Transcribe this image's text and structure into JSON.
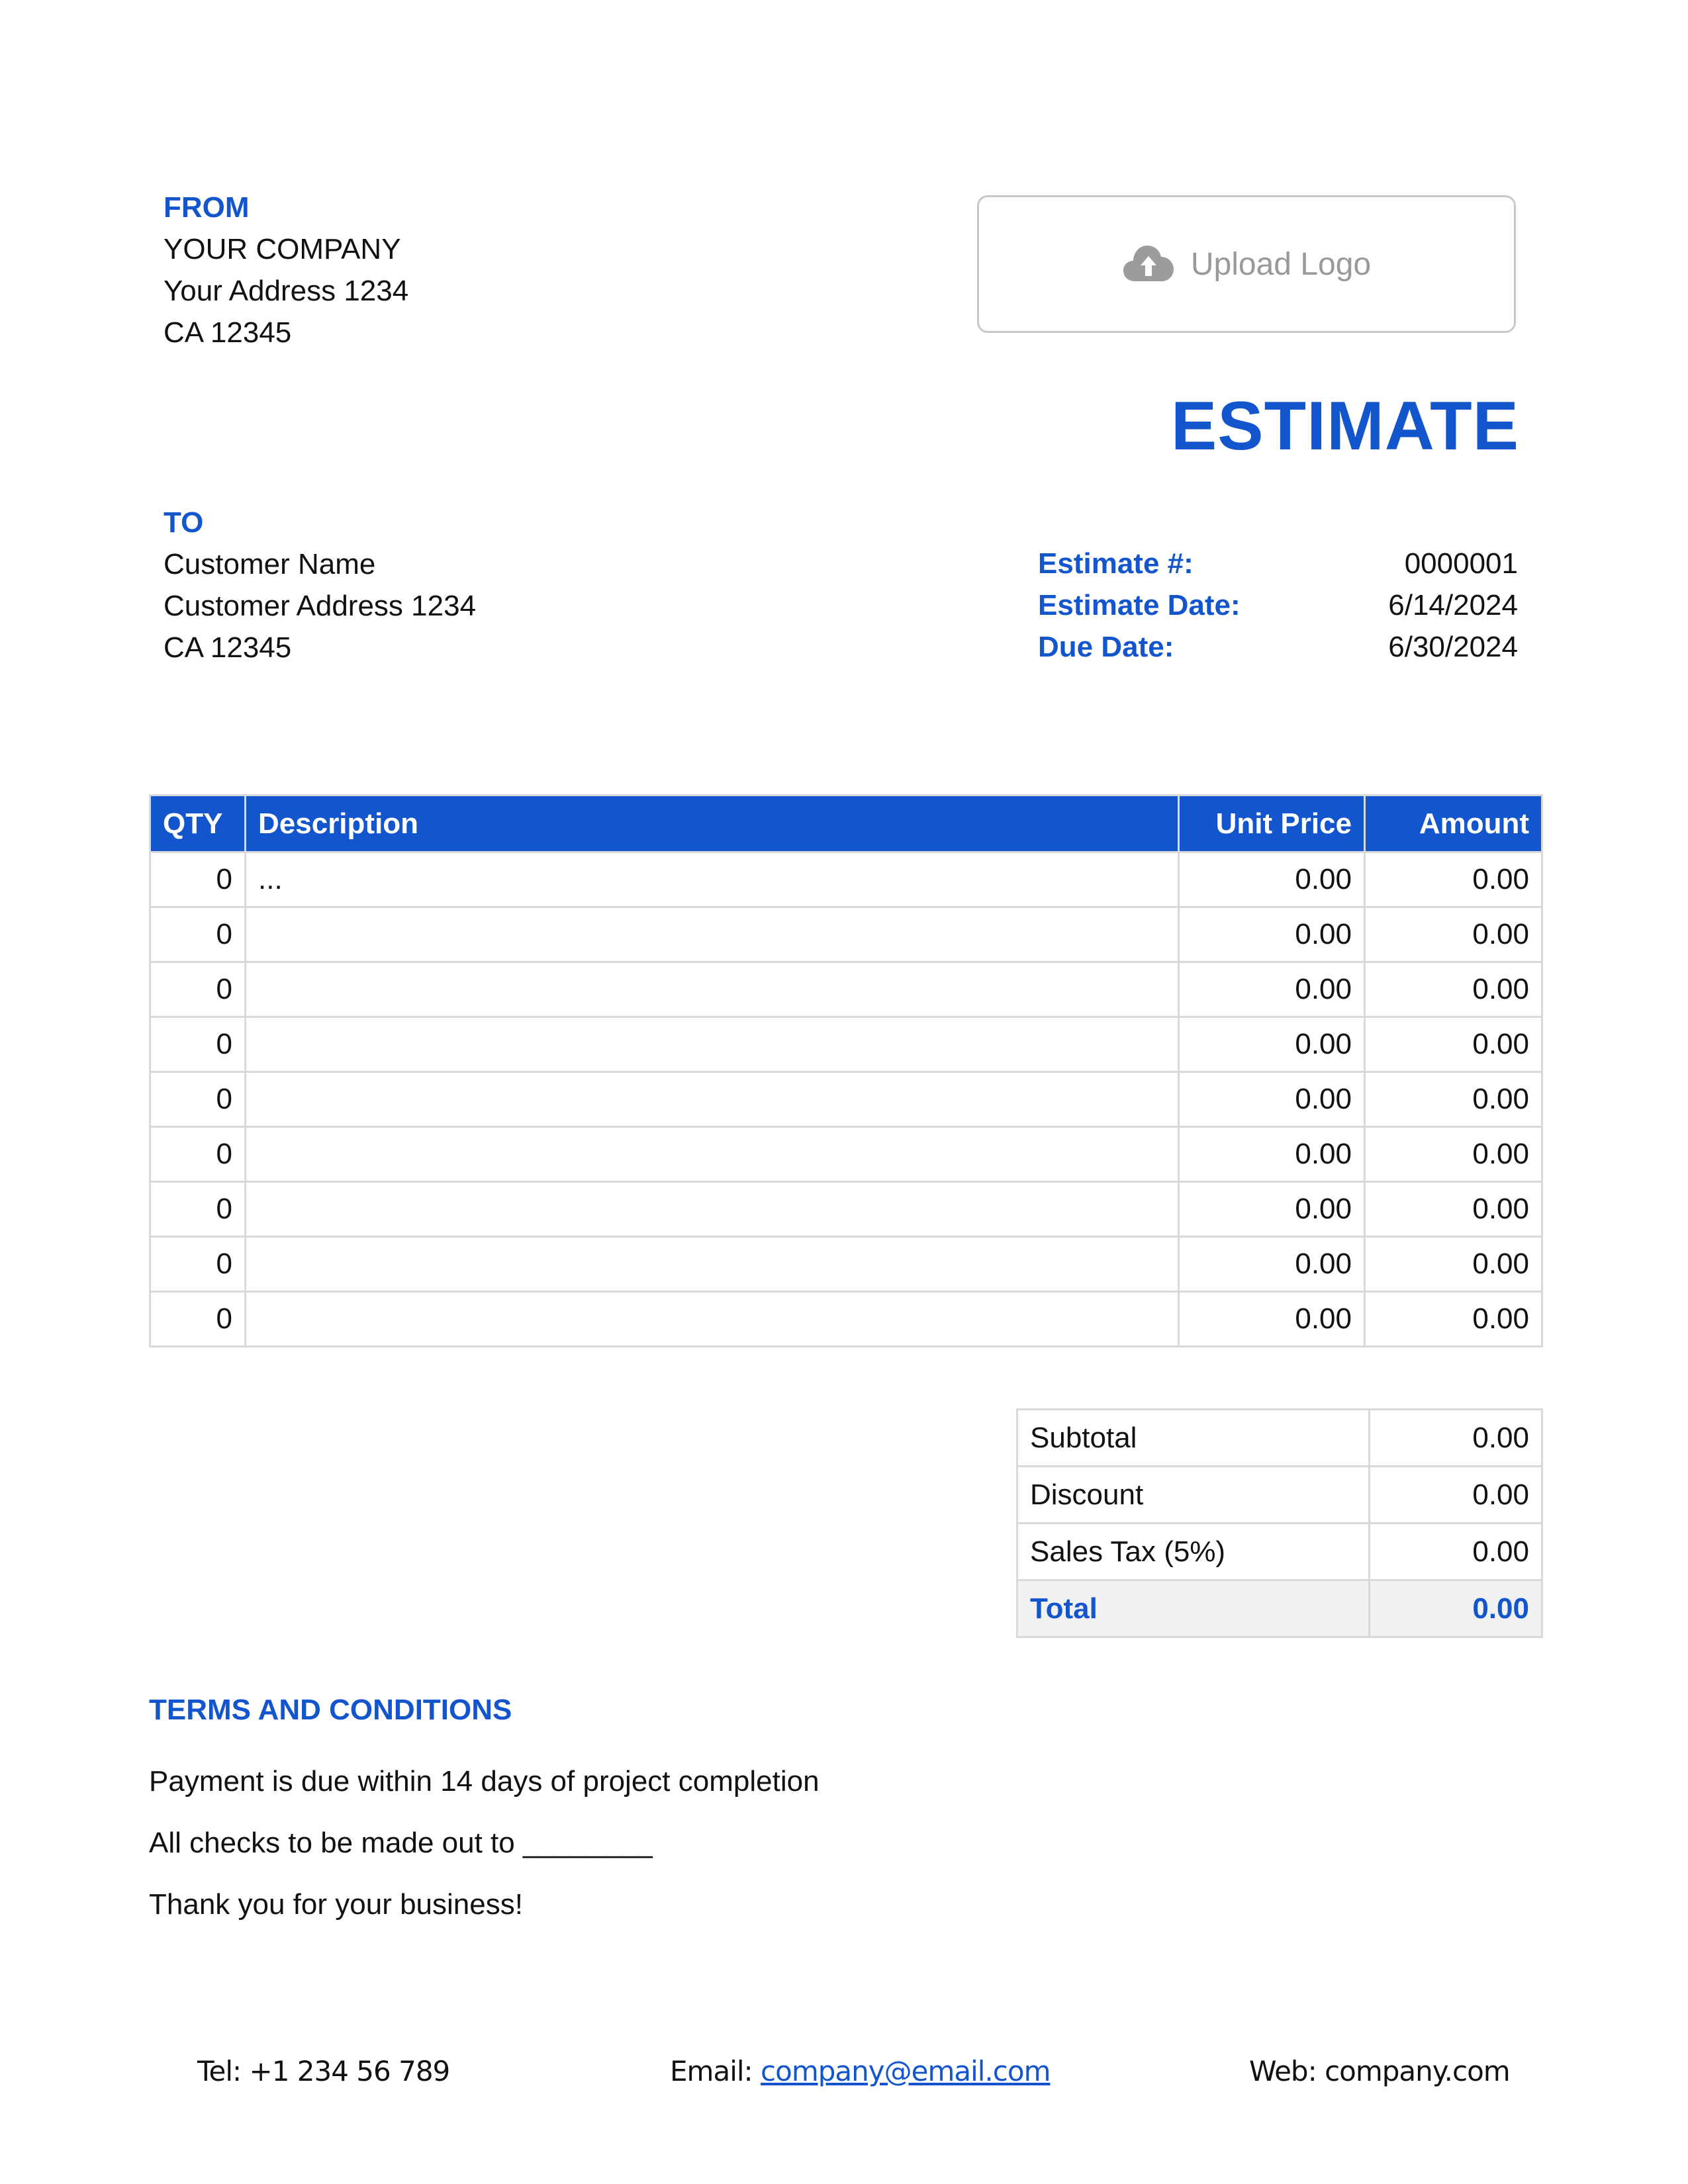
{
  "from": {
    "heading": "FROM",
    "lines": [
      "YOUR COMPANY",
      "Your Address 1234",
      "CA 12345"
    ]
  },
  "logo": {
    "label": "Upload Logo",
    "icon": "cloud-upload-icon"
  },
  "document_title": "ESTIMATE",
  "to": {
    "heading": "TO",
    "lines": [
      "Customer Name",
      "Customer Address 1234",
      "CA 12345"
    ]
  },
  "meta": [
    {
      "label": "Estimate #:",
      "value": "0000001"
    },
    {
      "label": "Estimate Date:",
      "value": "6/14/2024"
    },
    {
      "label": "Due Date:",
      "value": "6/30/2024"
    }
  ],
  "items": {
    "headers": {
      "qty": "QTY",
      "description": "Description",
      "unit_price": "Unit Price",
      "amount": "Amount"
    },
    "rows": [
      {
        "qty": "0",
        "description": "...",
        "unit_price": "0.00",
        "amount": "0.00"
      },
      {
        "qty": "0",
        "description": "",
        "unit_price": "0.00",
        "amount": "0.00"
      },
      {
        "qty": "0",
        "description": "",
        "unit_price": "0.00",
        "amount": "0.00"
      },
      {
        "qty": "0",
        "description": "",
        "unit_price": "0.00",
        "amount": "0.00"
      },
      {
        "qty": "0",
        "description": "",
        "unit_price": "0.00",
        "amount": "0.00"
      },
      {
        "qty": "0",
        "description": "",
        "unit_price": "0.00",
        "amount": "0.00"
      },
      {
        "qty": "0",
        "description": "",
        "unit_price": "0.00",
        "amount": "0.00"
      },
      {
        "qty": "0",
        "description": "",
        "unit_price": "0.00",
        "amount": "0.00"
      },
      {
        "qty": "0",
        "description": "",
        "unit_price": "0.00",
        "amount": "0.00"
      }
    ]
  },
  "totals": {
    "subtotal": {
      "label": "Subtotal",
      "value": "0.00"
    },
    "discount": {
      "label": "Discount",
      "value": "0.00"
    },
    "tax": {
      "label": "Sales Tax (5%)",
      "value": "0.00"
    },
    "total": {
      "label": "Total",
      "value": "0.00"
    }
  },
  "terms": {
    "heading": "TERMS AND CONDITIONS",
    "lines": [
      "Payment is due within 14 days of project completion",
      "All checks to be made out to ________",
      "Thank you for your business!"
    ]
  },
  "footer": {
    "tel": "Tel: +1 234 56 789",
    "email_label": "Email: ",
    "email": "company@email.com",
    "web": "Web: company.com"
  },
  "colors": {
    "accent": "#1355cc",
    "border": "#d9d9d9",
    "total_bg": "#f1f1f1"
  }
}
